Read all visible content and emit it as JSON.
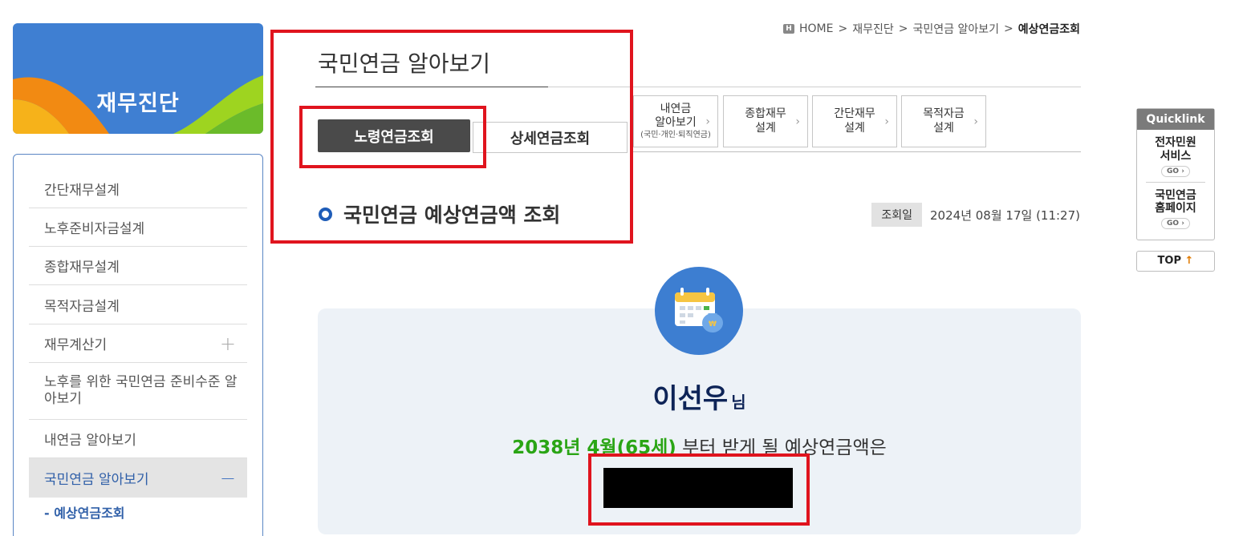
{
  "sidebar": {
    "banner_title": "재무진단",
    "items": [
      {
        "label": "간단재무설계"
      },
      {
        "label": "노후준비자금설계"
      },
      {
        "label": "종합재무설계"
      },
      {
        "label": "목적자금설계"
      },
      {
        "label": "재무계산기",
        "sign": "+"
      },
      {
        "label": "노후를 위한 국민연금 준비수준 알아보기"
      },
      {
        "label": "내연금 알아보기"
      },
      {
        "label": "국민연금 알아보기",
        "sign": "−",
        "active": true
      }
    ],
    "sub_item": "- 예상연금조회"
  },
  "breadcrumb": {
    "home_badge": "H",
    "items": [
      "HOME",
      "재무진단",
      "국민연금 알아보기",
      "예상연금조회"
    ],
    "separator": ">"
  },
  "page_title": "국민연금 알아보기",
  "tabs": {
    "active": "노령연금조회",
    "inactive": "상세연금조회"
  },
  "quick_buttons": [
    {
      "line1": "내연금",
      "line2": "알아보기",
      "sub": "(국민·개인·퇴직연금)"
    },
    {
      "line1": "종합재무",
      "line2": "설계"
    },
    {
      "line1": "간단재무",
      "line2": "설계"
    },
    {
      "line1": "목적자금",
      "line2": "설계"
    }
  ],
  "section_heading": "국민연금 예상연금액 조회",
  "query_date": {
    "label": "조회일",
    "value": "2024년 08월 17일 (11:27)"
  },
  "result": {
    "name": "이선우",
    "name_suffix": "님",
    "start_highlight": "2038년 4월(65세)",
    "start_text": " 부터 받게 될 예상연금액은"
  },
  "quicklink": {
    "header": "Quicklink",
    "items": [
      {
        "line1": "전자민원",
        "line2": "서비스",
        "go": "GO ›"
      },
      {
        "line1": "국민연금",
        "line2": "홈페이지",
        "go": "GO ›"
      }
    ]
  },
  "top_button": {
    "label": "TOP",
    "arrow": "↑"
  },
  "colors": {
    "accent_blue": "#3d7ed1",
    "highlight_red": "#e0141e",
    "green_text": "#2aa515",
    "name_navy": "#0e2457"
  }
}
